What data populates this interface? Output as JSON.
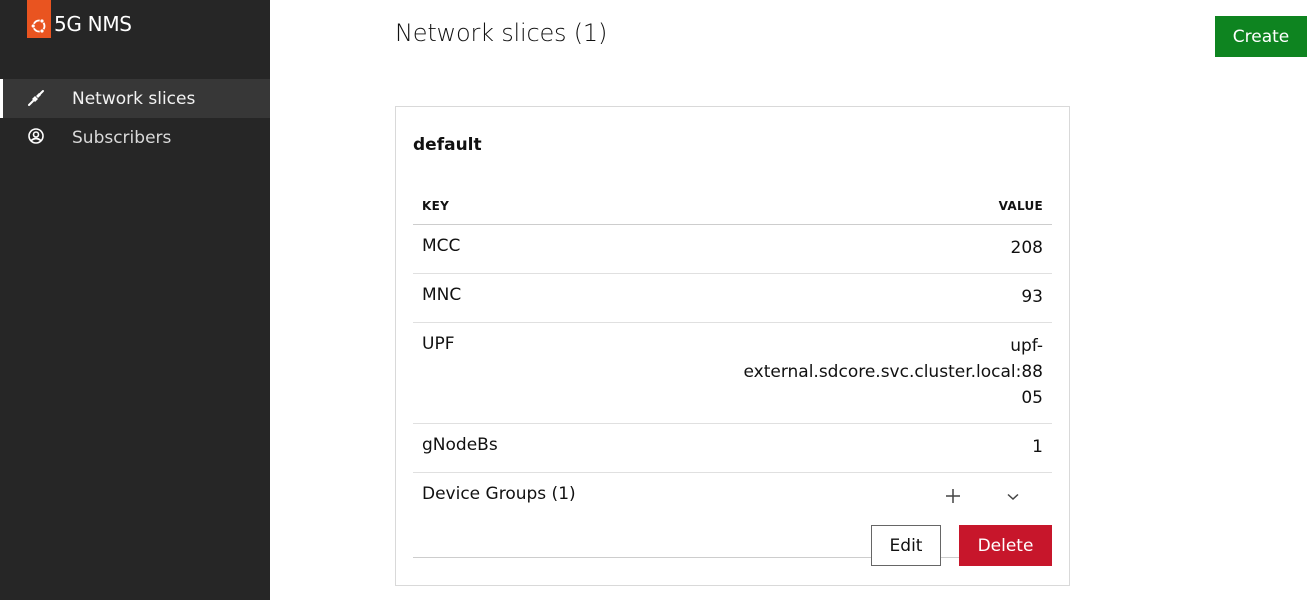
{
  "app": {
    "title": "5G NMS",
    "brand_color": "#e95420"
  },
  "sidebar": {
    "items": [
      {
        "label": "Network slices",
        "icon": "plug-icon",
        "active": true
      },
      {
        "label": "Subscribers",
        "icon": "user-circle-icon",
        "active": false
      }
    ]
  },
  "header": {
    "title": "Network slices (1)",
    "create_label": "Create",
    "create_color": "#0e8420"
  },
  "slice": {
    "name": "default",
    "table": {
      "key_header": "KEY",
      "value_header": "VALUE",
      "rows": [
        {
          "key": "MCC",
          "value": "208"
        },
        {
          "key": "MNC",
          "value": "93"
        },
        {
          "key": "UPF",
          "value": "upf-external.sdcore.svc.cluster.local:8805"
        },
        {
          "key": "gNodeBs",
          "value": "1"
        }
      ]
    },
    "device_groups": {
      "label": "Device Groups (1)",
      "add_icon": "plus-icon",
      "expand_icon": "chevron-down-icon"
    },
    "edit_label": "Edit",
    "delete_label": "Delete",
    "delete_color": "#c7162b"
  }
}
